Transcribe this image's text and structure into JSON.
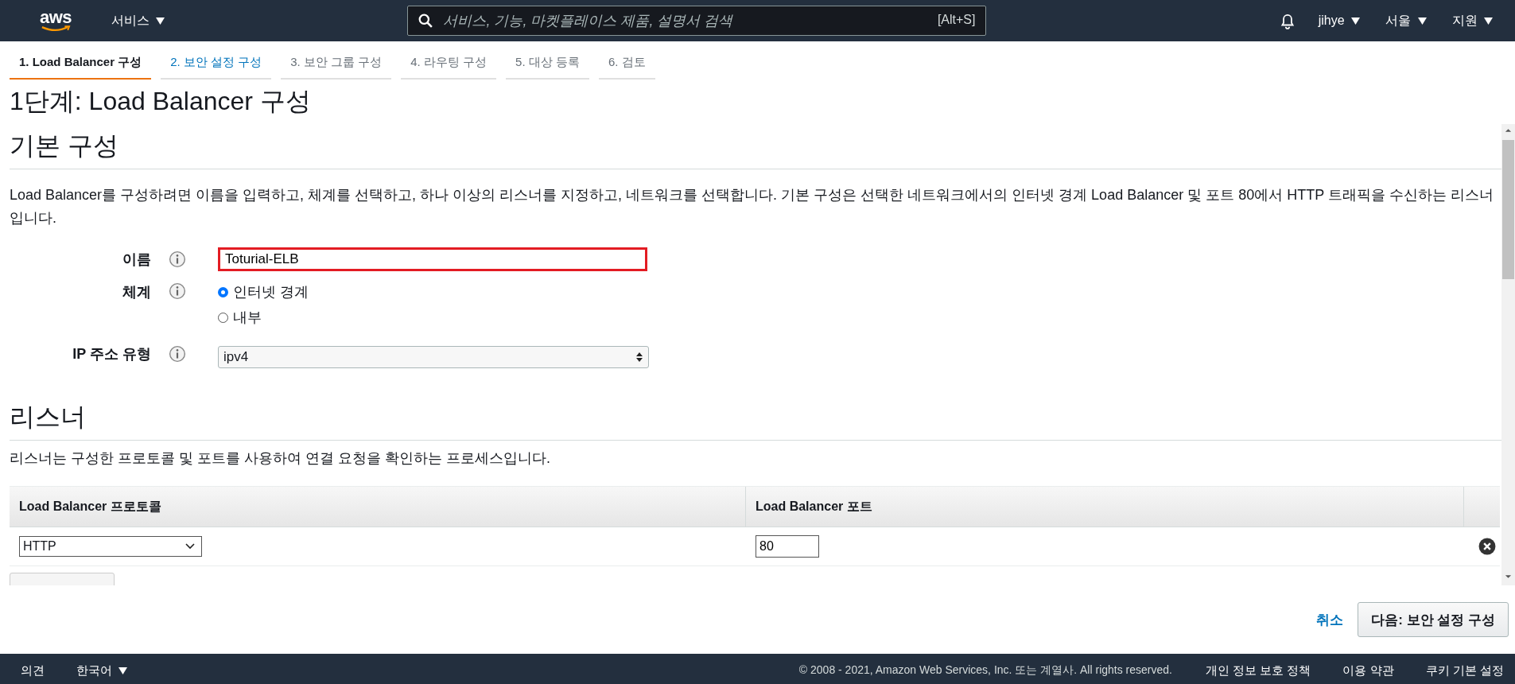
{
  "topbar": {
    "logo": "aws",
    "services_menu": "서비스",
    "search": {
      "placeholder": "서비스, 기능, 마켓플레이스 제품, 설명서 검색",
      "shortcut": "[Alt+S]"
    },
    "user_menu": "jihye",
    "region_menu": "서울",
    "support_menu": "지원"
  },
  "steps": [
    {
      "label": "1. Load Balancer 구성",
      "selected": true,
      "disabled": false
    },
    {
      "label": "2. 보안 설정 구성",
      "selected": false,
      "disabled": false
    },
    {
      "label": "3. 보안 그룹 구성",
      "selected": false,
      "disabled": true
    },
    {
      "label": "4. 라우팅 구성",
      "selected": false,
      "disabled": true
    },
    {
      "label": "5. 대상 등록",
      "selected": false,
      "disabled": true
    },
    {
      "label": "6. 검토",
      "selected": false,
      "disabled": true
    }
  ],
  "page_title": "1단계: Load Balancer 구성",
  "basic": {
    "heading": "기본 구성",
    "description": "Load Balancer를 구성하려면 이름을 입력하고, 체계를 선택하고, 하나 이상의 리스너를 지정하고, 네트워크를 선택합니다. 기본 구성은 선택한 네트워크에서의 인터넷 경계 Load Balancer 및 포트 80에서 HTTP 트래픽을 수신하는 리스너입니다.",
    "name": {
      "label": "이름",
      "value": "Toturial-ELB",
      "highlighted": true
    },
    "scheme": {
      "label": "체계",
      "options": [
        {
          "label": "인터넷 경계",
          "selected": true
        },
        {
          "label": "내부",
          "selected": false
        }
      ]
    },
    "ip_type": {
      "label": "IP 주소 유형",
      "value": "ipv4"
    }
  },
  "listeners": {
    "heading": "리스너",
    "description": "리스너는 구성한 프로토콜 및 포트를 사용하여 연결 요청을 확인하는 프로세스입니다.",
    "columns": [
      "Load Balancer 프로토콜",
      "Load Balancer 포트"
    ],
    "rows": [
      {
        "protocol": "HTTP",
        "port": "80"
      }
    ]
  },
  "actions": {
    "cancel": "취소",
    "next": "다음: 보안 설정 구성"
  },
  "footer": {
    "feedback": "의견",
    "language": "한국어",
    "copyright": "© 2008 - 2021, Amazon Web Services, Inc. 또는 계열사. All rights reserved.",
    "links": [
      "개인 정보 보호 정책",
      "이용 약관",
      "쿠키 기본 설정"
    ]
  }
}
